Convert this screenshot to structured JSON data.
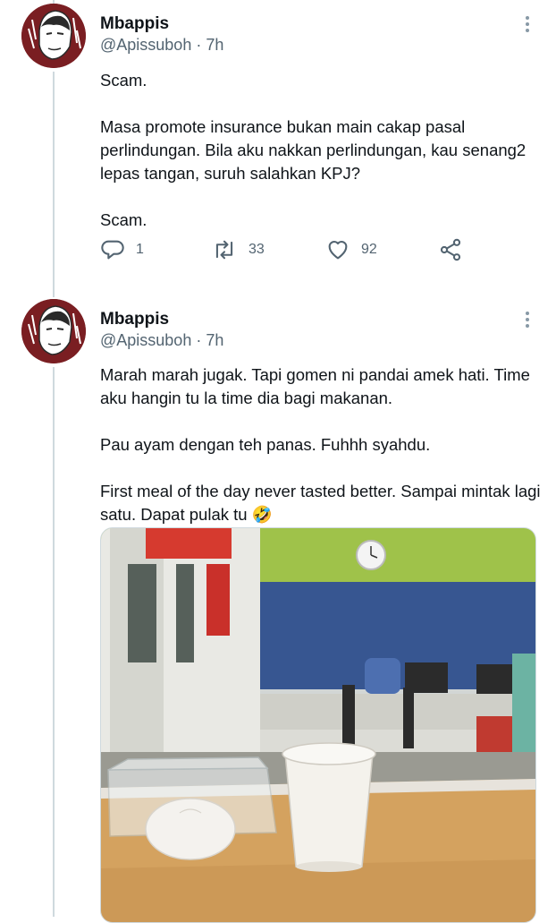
{
  "tweets": [
    {
      "name": "Mbappis",
      "handle": "@Apissuboh",
      "time": "7h",
      "paragraphs": [
        "Scam.",
        "Masa promote insurance bukan main cakap pasal perlindungan. Bila aku nakkan perlindungan, kau senang2 lepas tangan, suruh salahkan KPJ?",
        "Scam."
      ],
      "replies": "1",
      "retweets": "33",
      "likes": "92"
    },
    {
      "name": "Mbappis",
      "handle": "@Apissuboh",
      "time": "7h",
      "paragraphs": [
        "Marah marah jugak. Tapi gomen ni pandai amek hati. Time aku hangin tu la time dia bagi makanan.",
        "Pau ayam dengan teh panas. Fuhhh syahdu.",
        "First meal of the day never tasted better. Sampai mintak lagi satu. Dapat pulak tu 🤣"
      ]
    }
  ],
  "icons": {
    "reply": "reply-icon",
    "retweet": "retweet-icon",
    "like": "heart-icon",
    "share": "share-icon",
    "more": "more-icon"
  },
  "colors": {
    "avatar_bg": "#7a1e22",
    "muted_text": "#536471",
    "thread_line": "#cfd9de"
  }
}
